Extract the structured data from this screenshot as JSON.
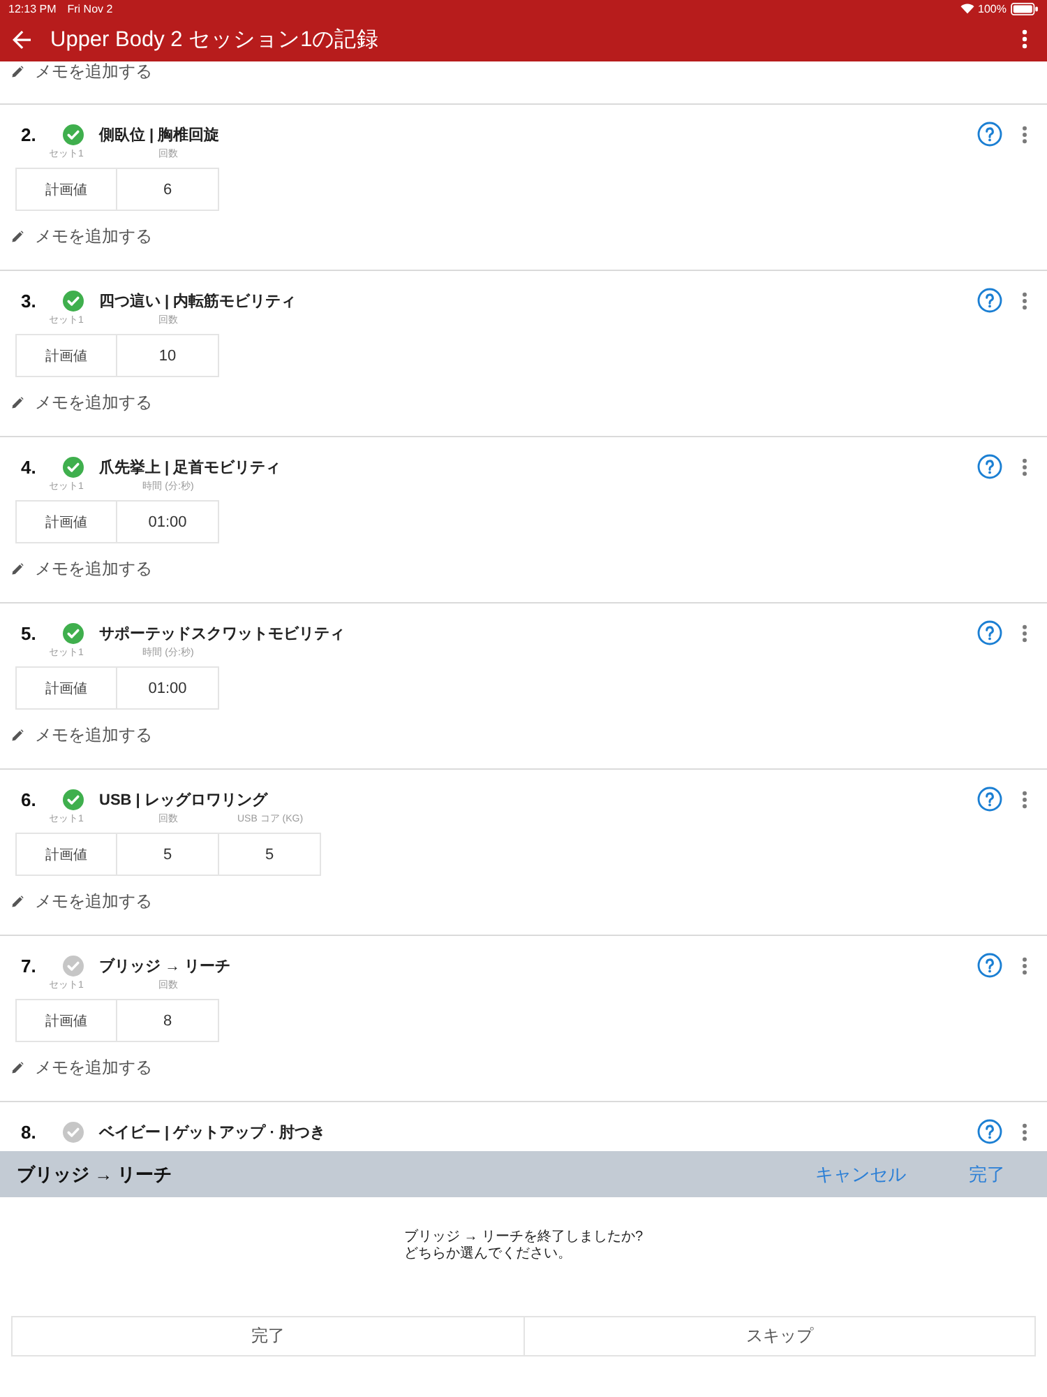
{
  "status_bar": {
    "time": "12:13 PM",
    "date": "Fri Nov 2",
    "battery": "100%"
  },
  "app_bar": {
    "title": "Upper Body 2 セッション1の記録"
  },
  "exercises": [
    {
      "memo": "メモを追加する"
    },
    {
      "number": "2.",
      "done": true,
      "name": "側臥位 | 胸椎回旋",
      "table": {
        "set": "セット1",
        "columns": [
          "回数"
        ],
        "row_label": "計画値",
        "values": [
          "6"
        ]
      },
      "memo": "メモを追加する"
    },
    {
      "number": "3.",
      "done": true,
      "name": "四つ這い | 内転筋モビリティ",
      "table": {
        "set": "セット1",
        "columns": [
          "回数"
        ],
        "row_label": "計画値",
        "values": [
          "10"
        ]
      },
      "memo": "メモを追加する"
    },
    {
      "number": "4.",
      "done": true,
      "name": "爪先挙上 | 足首モビリティ",
      "table": {
        "set": "セット1",
        "columns": [
          "時間 (分:秒)"
        ],
        "row_label": "計画値",
        "values": [
          "01:00"
        ]
      },
      "memo": "メモを追加する"
    },
    {
      "number": "5.",
      "done": true,
      "name": "サポーテッドスクワットモビリティ",
      "table": {
        "set": "セット1",
        "columns": [
          "時間 (分:秒)"
        ],
        "row_label": "計画値",
        "values": [
          "01:00"
        ]
      },
      "memo": "メモを追加する"
    },
    {
      "number": "6.",
      "done": true,
      "name": "USB | レッグロワリング",
      "table": {
        "set": "セット1",
        "columns": [
          "回数",
          "USB コア (KG)"
        ],
        "row_label": "計画値",
        "values": [
          "5",
          "5"
        ]
      },
      "memo": "メモを追加する"
    },
    {
      "number": "7.",
      "done": false,
      "name": "ブリッジ → リーチ",
      "table": {
        "set": "セット1",
        "columns": [
          "回数"
        ],
        "row_label": "計画値",
        "values": [
          "8"
        ]
      },
      "memo": "メモを追加する"
    },
    {
      "number": "8.",
      "done": false,
      "name": "ベイビー | ゲットアップ · 肘つき"
    }
  ],
  "sheet": {
    "title": "ブリッジ → リーチ",
    "cancel": "キャンセル",
    "confirm": "完了",
    "message": "ブリッジ → リーチを終了しましたか?\nどちらか選んでください。",
    "buttons": [
      "完了",
      "スキップ"
    ]
  }
}
